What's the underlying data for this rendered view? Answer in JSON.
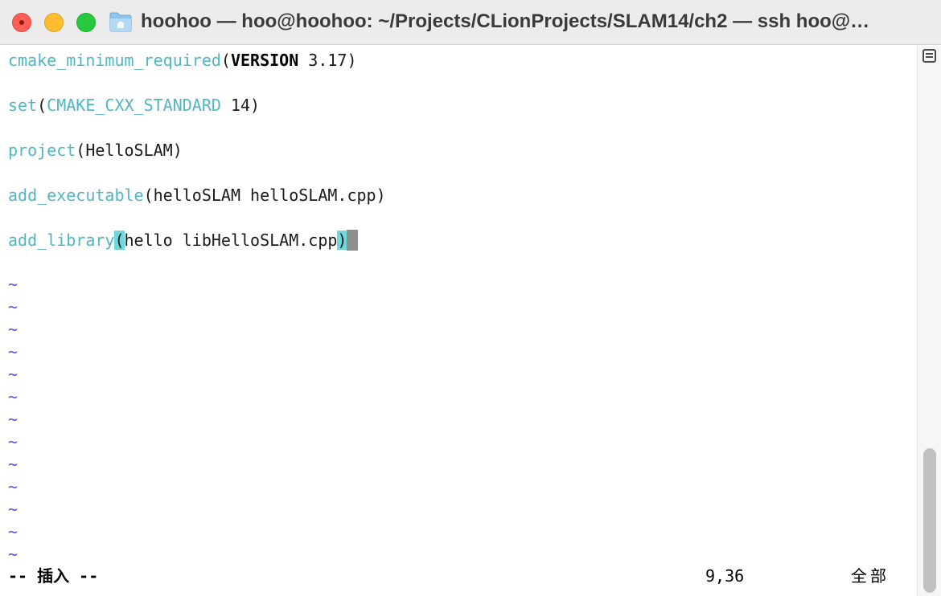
{
  "window": {
    "title": "hoohoo — hoo@hoohoo: ~/Projects/CLionProjects/SLAM14/ch2 — ssh hoo@…",
    "colors": {
      "close": "#ff5f57",
      "minimize": "#febc2e",
      "maximize": "#28c840",
      "keyword": "#4fb6c6",
      "tilde": "#5b56d6",
      "paren_highlight": "#6fd7de",
      "cursor": "#8d8d8d"
    },
    "icon": "folder-icon"
  },
  "editor": {
    "lines": [
      {
        "func": "cmake_minimum_required",
        "open": "(",
        "arg_bold": "VERSION",
        "arg": " 3.17",
        "close": ")"
      },
      {
        "func": "set",
        "open": "(",
        "arg_kw": "CMAKE_CXX_STANDARD",
        "arg": " 14",
        "close": ")"
      },
      {
        "func": "project",
        "open": "(",
        "arg": "HelloSLAM",
        "close": ")"
      },
      {
        "func": "add_executable",
        "open": "(",
        "arg": "helloSLAM helloSLAM.cpp",
        "close": ")"
      },
      {
        "func": "add_library",
        "open": "(",
        "arg": "hello libHelloSLAM.cpp",
        "close": ")"
      }
    ],
    "tilde": "~",
    "tilde_count": 13
  },
  "statusline": {
    "mode": "-- 插入 --",
    "position": "9,36",
    "scroll": "全部"
  }
}
